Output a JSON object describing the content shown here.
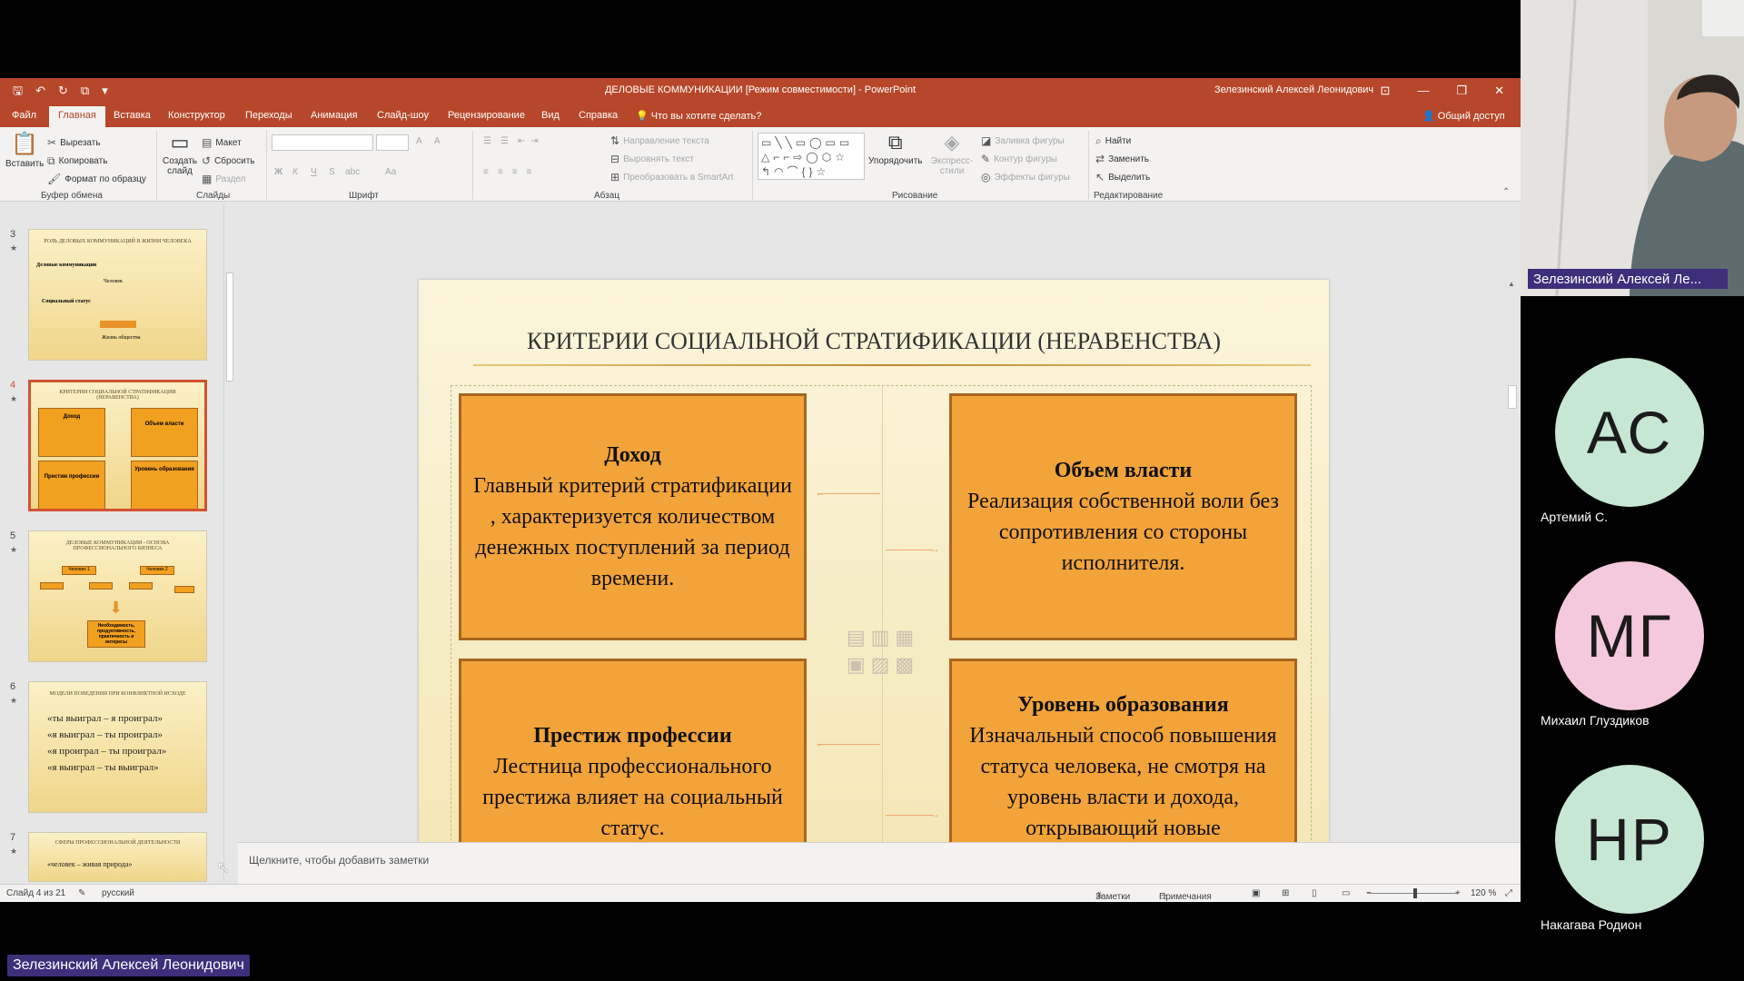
{
  "window": {
    "title": "ДЕЛОВЫЕ КОММУНИКАЦИИ [Режим совместимости] - PowerPoint",
    "user": "Зелезинский Алексей Леонидович"
  },
  "tabs": [
    "Файл",
    "Главная",
    "Вставка",
    "Конструктор",
    "Переходы",
    "Анимация",
    "Слайд-шоу",
    "Рецензирование",
    "Вид",
    "Справка"
  ],
  "tell_me": "Что вы хотите сделать?",
  "share": "Общий доступ",
  "ribbon": {
    "clipboard": {
      "paste": "Вставить",
      "cut": "Вырезать",
      "copy": "Копировать",
      "format": "Формат по образцу",
      "label": "Буфер обмена"
    },
    "slides": {
      "new": "Создать слайд",
      "layout": "Макет",
      "reset": "Сбросить",
      "section": "Раздел",
      "label": "Слайды"
    },
    "font": {
      "label": "Шрифт",
      "bold": "Ж",
      "italic": "К",
      "underline": "Ч",
      "strike": "S",
      "spacing": "abc",
      "case": "Aa",
      "grow": "A",
      "shrink": "A"
    },
    "paragraph": {
      "direction": "Направление текста",
      "align": "Выровнять текст",
      "smartart": "Преобразовать в SmartArt",
      "label": "Абзац"
    },
    "drawing": {
      "arrange": "Упорядочить",
      "styles": "Экспресс-стили",
      "fill": "Заливка фигуры",
      "outline": "Контур фигуры",
      "effects": "Эффекты фигуры",
      "label": "Рисование"
    },
    "editing": {
      "find": "Найти",
      "replace": "Заменить",
      "select": "Выделить",
      "label": "Редактирование"
    }
  },
  "thumbnails": [
    {
      "num": "3",
      "title": "РОЛЬ ДЕЛОВЫХ КОММУНИКАЦИЙ В ЖИЗНИ ЧЕЛОВЕКА",
      "line1": "Деловые коммуникации",
      "center": "Человек",
      "left_label": "Социальный статус",
      "bottom": "Жизнь общества"
    },
    {
      "num": "4",
      "title": "КРИТЕРИИ СОЦИАЛЬНОЙ СТРАТИФИКАЦИИ (НЕРАВЕНСТВА)",
      "b1": "Доход",
      "b2": "Объем власти",
      "b3": "Престиж профессии",
      "b4": "Уровень образования"
    },
    {
      "num": "5",
      "title": "ДЕЛОВЫЕ КОММУНИКАЦИИ - ОСНОВА ПРОФЕССИОНАЛЬНОГО БИЗНЕСА",
      "p1": "Человек 1",
      "p2": "Человек 2",
      "result": "Необходимость, продуктивность, практичность и интересы"
    },
    {
      "num": "6",
      "title": "МОДЕЛИ ПОВЕДЕНИЯ ПРИ КОНФЛИКТНОЙ ИСХОДЕ",
      "lines": [
        "«ты выиграл – я проиграл»",
        "«я выиграл – ты проиграл»",
        "«я проиграл – ты проиграл»",
        "«я выиграл – ты выиграл»"
      ]
    },
    {
      "num": "7",
      "title": "СФЕРЫ ПРОФЕССИОНАЛЬНОЙ ДЕЯТЕЛЬНОСТИ",
      "line1": "«человек – живая природа»"
    }
  ],
  "slide": {
    "title": "КРИТЕРИИ СОЦИАЛЬНОЙ СТРАТИФИКАЦИИ (НЕРАВЕНСТВА)",
    "boxes": [
      {
        "heading": "Доход",
        "text": "Главный критерий стратификации , характеризуется количеством денежных поступлений за период времени."
      },
      {
        "heading": "Объем власти",
        "text": "Реализация собственной воли без сопротивления со стороны исполнителя."
      },
      {
        "heading": "Престиж профессии",
        "text": "Лестница профессионального престижа влияет на социальный статус."
      },
      {
        "heading": "Уровень образования",
        "text": "Изначальный способ повышения статуса человека, не смотря на уровень власти и дохода, открывающий новые перспективы."
      }
    ]
  },
  "notes_placeholder": "Щелкните, чтобы добавить заметки",
  "status": {
    "slide": "Слайд 4 из 21",
    "lang": "русский",
    "notes": "Заметки",
    "comments": "Примечания",
    "zoom": "120 %"
  },
  "participants": {
    "cam_name": "Зелезинский Алексей Ле...",
    "list": [
      {
        "initials": "АС",
        "name": "Артемий С.",
        "color": "#c6e7d3"
      },
      {
        "initials": "МГ",
        "name": "Михаил Глуздиков",
        "color": "#f4c9dd"
      },
      {
        "initials": "НР",
        "name": "Накагава Родион",
        "color": "#c6e7d3"
      }
    ],
    "presenter": "Зелезинский Алексей Леонидович"
  }
}
